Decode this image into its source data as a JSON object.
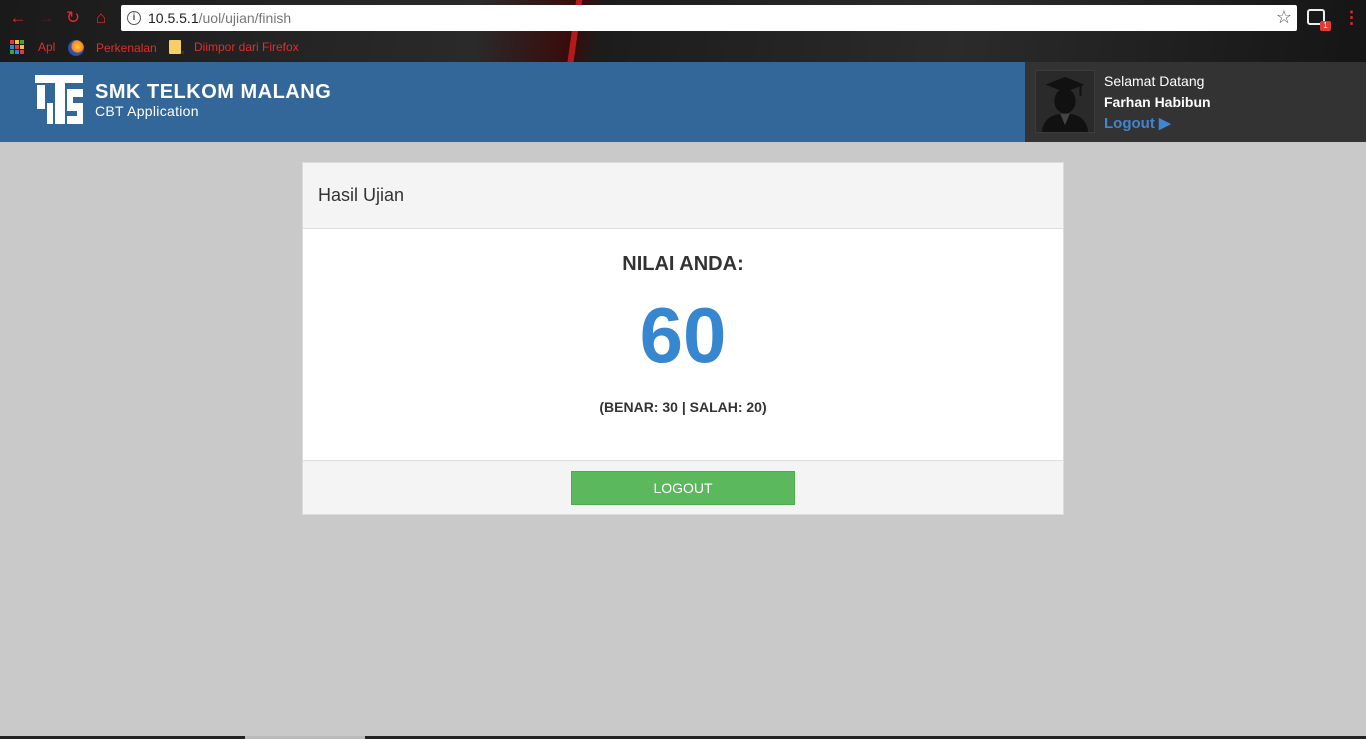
{
  "browser": {
    "url_host": "10.5.5.1",
    "url_path": "/uol/ujian/finish",
    "extension_badge": "1",
    "bookmarks": [
      {
        "label": "Apl",
        "icon": "apps-grid-icon"
      },
      {
        "label": "Perkenalan",
        "icon": "firefox-icon"
      },
      {
        "label": "Diimpor dari Firefox",
        "icon": "folder-icon"
      }
    ],
    "accent_color": "#e52b2b"
  },
  "header": {
    "school_name": "SMK TELKOM MALANG",
    "app_name": "CBT Application",
    "background_color": "#336699",
    "user": {
      "greeting": "Selamat Datang",
      "name": "Farhan Habibun",
      "logout_label": "Logout ▶",
      "avatar_icon": "graduate-avatar-icon"
    }
  },
  "result": {
    "title": "Hasil Ujian",
    "score_label": "NILAI ANDA:",
    "score": "60",
    "detail": "(BENAR: 30 | SALAH: 20)",
    "score_color": "#3687cf",
    "logout_button_label": "LOGOUT",
    "button_color": "#5cb85c"
  }
}
